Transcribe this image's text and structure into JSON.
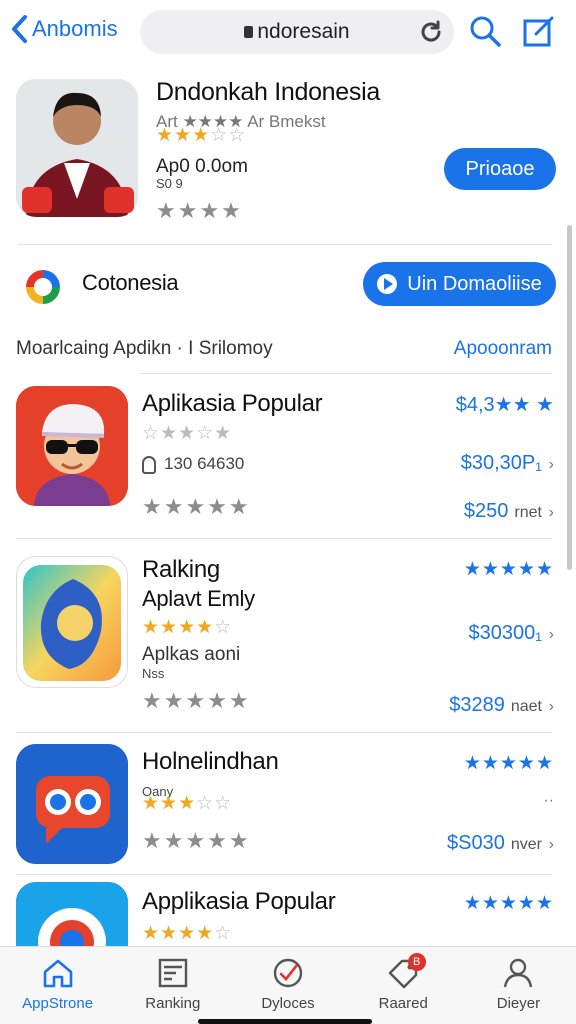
{
  "top": {
    "back_label": "Anbomis",
    "url": "ndoresain"
  },
  "featured": {
    "title": "Dndonkah Indonesia",
    "rating_text": "Art ★★★★ Ar Bmekst",
    "meta1": "Ap0 0.0om",
    "meta2": "S0 9",
    "button": "Prioaoe"
  },
  "section": {
    "name": "Cotonesia",
    "button": "Uin Domaoliise",
    "heading": "Moarlcaing Apdikn · I Srilomoy",
    "link": "Apooonram"
  },
  "apps": [
    {
      "title": "Aplikasia Popular",
      "price_top": "$4,3★★ ★",
      "meta": "130 64630",
      "price_mid": "$30,30P₁",
      "price_bot": "$250",
      "price_bot_note": "rnet"
    },
    {
      "title": "Ralking",
      "title2": "Aplavt Emly",
      "meta": "Aplkas aoni",
      "meta2": "Nss",
      "price_mid": "$30300₁",
      "price_bot": "$3289",
      "price_bot_note": "naet"
    },
    {
      "title": "Holnelindhan",
      "meta": "Oany",
      "price_bot": "$S030",
      "price_bot_note": "nver"
    },
    {
      "title": "Applikasia Popular"
    }
  ],
  "tabs": [
    {
      "label": "AppStrone",
      "icon": "home-icon"
    },
    {
      "label": "Ranking",
      "icon": "chart-icon"
    },
    {
      "label": "Dyloces",
      "icon": "check-icon"
    },
    {
      "label": "Raared",
      "icon": "tag-icon",
      "badge": "B"
    },
    {
      "label": "Dieyer",
      "icon": "person-icon"
    }
  ],
  "colors": {
    "accent": "#1a73e8",
    "star": "#f0a820",
    "tabbar": "#f7f7f8"
  }
}
